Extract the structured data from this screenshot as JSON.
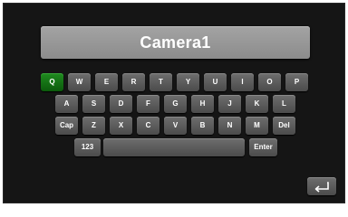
{
  "name_field": {
    "value": "Camera1"
  },
  "keyboard": {
    "row1": [
      "Q",
      "W",
      "E",
      "R",
      "T",
      "Y",
      "U",
      "I",
      "O",
      "P"
    ],
    "row2": [
      "A",
      "S",
      "D",
      "F",
      "G",
      "H",
      "J",
      "K",
      "L"
    ],
    "row3": [
      "Cap",
      "Z",
      "X",
      "C",
      "V",
      "B",
      "N",
      "M",
      "Del"
    ],
    "row4": {
      "numbers_label": "123",
      "space_label": "",
      "enter_label": "Enter"
    },
    "selected_key": "Q",
    "selected_color": "#127312"
  },
  "back_button": {
    "icon": "return-arrow-icon"
  }
}
